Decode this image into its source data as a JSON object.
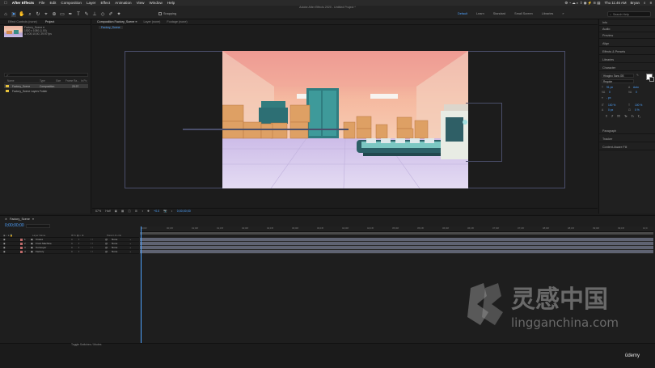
{
  "menubar": {
    "apple": "",
    "items": [
      "After Effects",
      "File",
      "Edit",
      "Composition",
      "Layer",
      "Effect",
      "Animation",
      "View",
      "Window",
      "Help"
    ],
    "clock": "Thu 11:46 AM",
    "user": "Bryan"
  },
  "toolbar": {
    "window_title": "Adobe After Effects 2020 - Untitled Project *",
    "tools": [
      "home-icon",
      "selection-tool-icon",
      "hand-tool-icon",
      "zoom-tool-icon",
      "rotate-tool-icon",
      "camera-tool-icon",
      "pan-behind-tool-icon",
      "rectangle-tool-icon",
      "pen-tool-icon",
      "type-tool-icon",
      "brush-tool-icon",
      "clone-stamp-tool-icon",
      "eraser-tool-icon",
      "roto-brush-tool-icon",
      "puppet-tool-icon"
    ],
    "snapping_label": "Snapping",
    "workspaces": [
      "Default",
      "Learn",
      "Standard",
      "Small Screen",
      "Libraries"
    ],
    "workspace_more": "»",
    "search_placeholder": "Search Help"
  },
  "project_panel": {
    "tabs": [
      "Effect Controls (none)",
      "Project"
    ],
    "thumb_info": [
      "Factory_Scene ▾",
      "1920 x 1080 (1.00)",
      "Δ 0;00;10;00, 29.97 fps"
    ],
    "search_placeholder": "ρ~",
    "columns": [
      "Name",
      "Type",
      "Size",
      "Frame Ra...",
      "In Po"
    ],
    "items": [
      {
        "name": "Factory_Scene",
        "type": "Composition",
        "rate": "29.97",
        "color": "#e6c23c"
      },
      {
        "name": "Factory_Scene Layers",
        "type": "Folder",
        "rate": "",
        "color": "#e6c23c"
      }
    ],
    "bpc": "8 bpc"
  },
  "comp_panel": {
    "tabs": [
      "Composition Factory_Scene ≡",
      "Layer (none)",
      "Footage (none)"
    ],
    "comp_name": "Factory_Scene",
    "viewer": {
      "zoom": "67%",
      "resolution": "Half",
      "exposure": "+0.0",
      "timecode": "0;00;00;00"
    }
  },
  "right_panel": {
    "items": [
      "Info",
      "Audio",
      "Preview",
      "Align",
      "Effects & Presets",
      "Libraries",
      "Character"
    ],
    "character": {
      "font": "Hiragino Sans GB",
      "style": "Regular",
      "size": "91 px",
      "leading": "Auto",
      "kerning": "0",
      "tracking": "0",
      "stroke": "- px",
      "vscale": "100 %",
      "hscale": "100 %",
      "baseline": "0 px",
      "tsume": "0 %",
      "styles": [
        "T",
        "T",
        "TT",
        "Tт",
        "T¹",
        "T₁"
      ],
      "fill_color": "#ffffff",
      "stroke_color": "#1a1a1a"
    },
    "bottom_items": [
      "Paragraph",
      "Tracker",
      "Content-Aware Fill"
    ]
  },
  "timeline": {
    "comp_tab": "Factory_Scene",
    "timecode": "0;00;00;00",
    "ruler": [
      "0;00f",
      "00;15f",
      "01;00f",
      "01;15f",
      "02;00f",
      "02;15f",
      "03;00f",
      "03;15f",
      "04;00f",
      "04;15f",
      "05;00f",
      "05;15f",
      "06;00f",
      "06;15f",
      "07;00f",
      "07;15f",
      "08;00f",
      "08;15f",
      "09;00f",
      "09;15f",
      "10;0"
    ],
    "columns": {
      "layer_name": "Layer Name",
      "parent": "Parent & Link"
    },
    "layers": [
      {
        "num": "1",
        "name": "Crates",
        "parent": "None",
        "color": "#c06a6a"
      },
      {
        "num": "2",
        "name": "Front Machine",
        "parent": "None",
        "color": "#c06a6a"
      },
      {
        "num": "3",
        "name": "Conveyer",
        "parent": "None",
        "color": "#c06a6a"
      },
      {
        "num": "4",
        "name": "Factory",
        "parent": "None",
        "color": "#c06a6a"
      }
    ],
    "toggle_label": "Toggle Switches / Modes"
  },
  "watermark": {
    "logo_text": "灵感中国",
    "domain": "lingganchina.com"
  },
  "udemy": "ûdemy"
}
